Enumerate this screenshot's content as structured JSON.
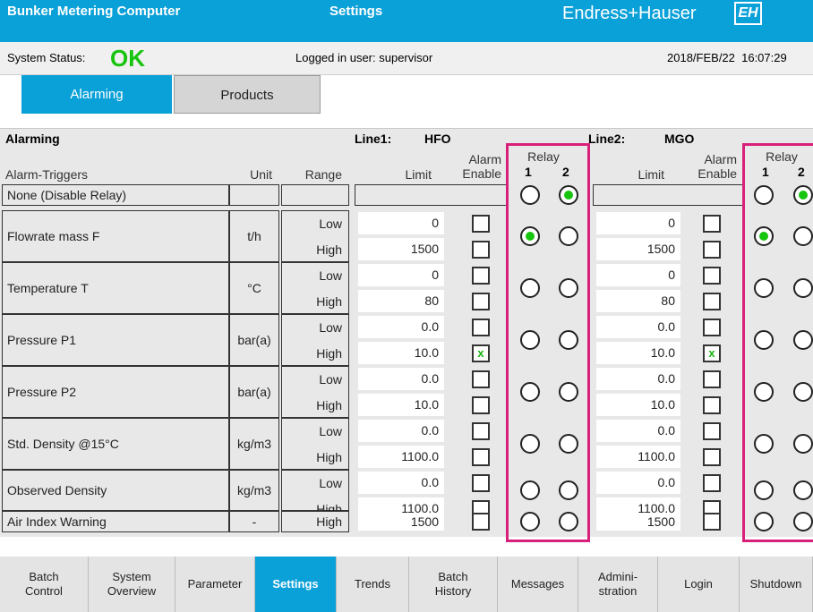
{
  "header": {
    "app_title": "Bunker Metering Computer",
    "page_title": "Settings",
    "brand": "Endress+Hauser",
    "brand_mark": "EH"
  },
  "status": {
    "label": "System Status:",
    "value": "OK",
    "user": "Logged in user: supervisor",
    "datetime": "2018/FEB/22  16:07:29"
  },
  "tabs": [
    "Alarming",
    "Products"
  ],
  "section": {
    "title": "Alarming",
    "line1_label": "Line1:",
    "line1_product": "HFO",
    "line2_label": "Line2:",
    "line2_product": "MGO"
  },
  "columns": {
    "triggers": "Alarm-Triggers",
    "unit": "Unit",
    "range": "Range",
    "limit": "Limit",
    "alarm": "Alarm",
    "enable": "Enable",
    "relay": "Relay",
    "relay1": "1",
    "relay2": "2"
  },
  "rows": [
    {
      "name": "None (Disable Relay)",
      "unit": "",
      "ranges": [],
      "l1": [],
      "l2": []
    },
    {
      "name": "Flowrate mass F",
      "unit": "t/h",
      "ranges": [
        "Low",
        "High"
      ],
      "l1": [
        "0",
        "1500"
      ],
      "l2": [
        "0",
        "1500"
      ]
    },
    {
      "name": "Temperature T",
      "unit": "°C",
      "ranges": [
        "Low",
        "High"
      ],
      "l1": [
        "0",
        "80"
      ],
      "l2": [
        "0",
        "80"
      ]
    },
    {
      "name": "Pressure P1",
      "unit": "bar(a)",
      "ranges": [
        "Low",
        "High"
      ],
      "l1": [
        "0.0",
        "10.0"
      ],
      "l2": [
        "0.0",
        "10.0"
      ]
    },
    {
      "name": "Pressure P2",
      "unit": "bar(a)",
      "ranges": [
        "Low",
        "High"
      ],
      "l1": [
        "0.0",
        "10.0"
      ],
      "l2": [
        "0.0",
        "10.0"
      ]
    },
    {
      "name": "Std. Density @15°C",
      "unit": "kg/m3",
      "ranges": [
        "Low",
        "High"
      ],
      "l1": [
        "0.0",
        "1100.0"
      ],
      "l2": [
        "0.0",
        "1100.0"
      ]
    },
    {
      "name": "Observed Density",
      "unit": "kg/m3",
      "ranges": [
        "Low",
        "High"
      ],
      "l1": [
        "0.0",
        "1100.0"
      ],
      "l2": [
        "0.0",
        "1100.0"
      ]
    },
    {
      "name": "Air Index Warning",
      "unit": "-",
      "ranges": [
        "High"
      ],
      "l1": [
        "1500"
      ],
      "l2": [
        "1500"
      ]
    }
  ],
  "checkbox_mark": "x",
  "nav": [
    {
      "label": "Batch\nControl",
      "active": false
    },
    {
      "label": "System\nOverview",
      "active": false
    },
    {
      "label": "Parameter",
      "active": false
    },
    {
      "label": "Settings",
      "active": true
    },
    {
      "label": "Trends",
      "active": false
    },
    {
      "label": "Batch\nHistory",
      "active": false
    },
    {
      "label": "Messages",
      "active": false
    },
    {
      "label": "Admini-\nstration",
      "active": false
    },
    {
      "label": "Login",
      "active": false
    },
    {
      "label": "Shutdown",
      "active": false
    }
  ],
  "colors": {
    "accent": "#0aa0d8",
    "ok": "#17c40e",
    "highlight": "#d8207a"
  }
}
